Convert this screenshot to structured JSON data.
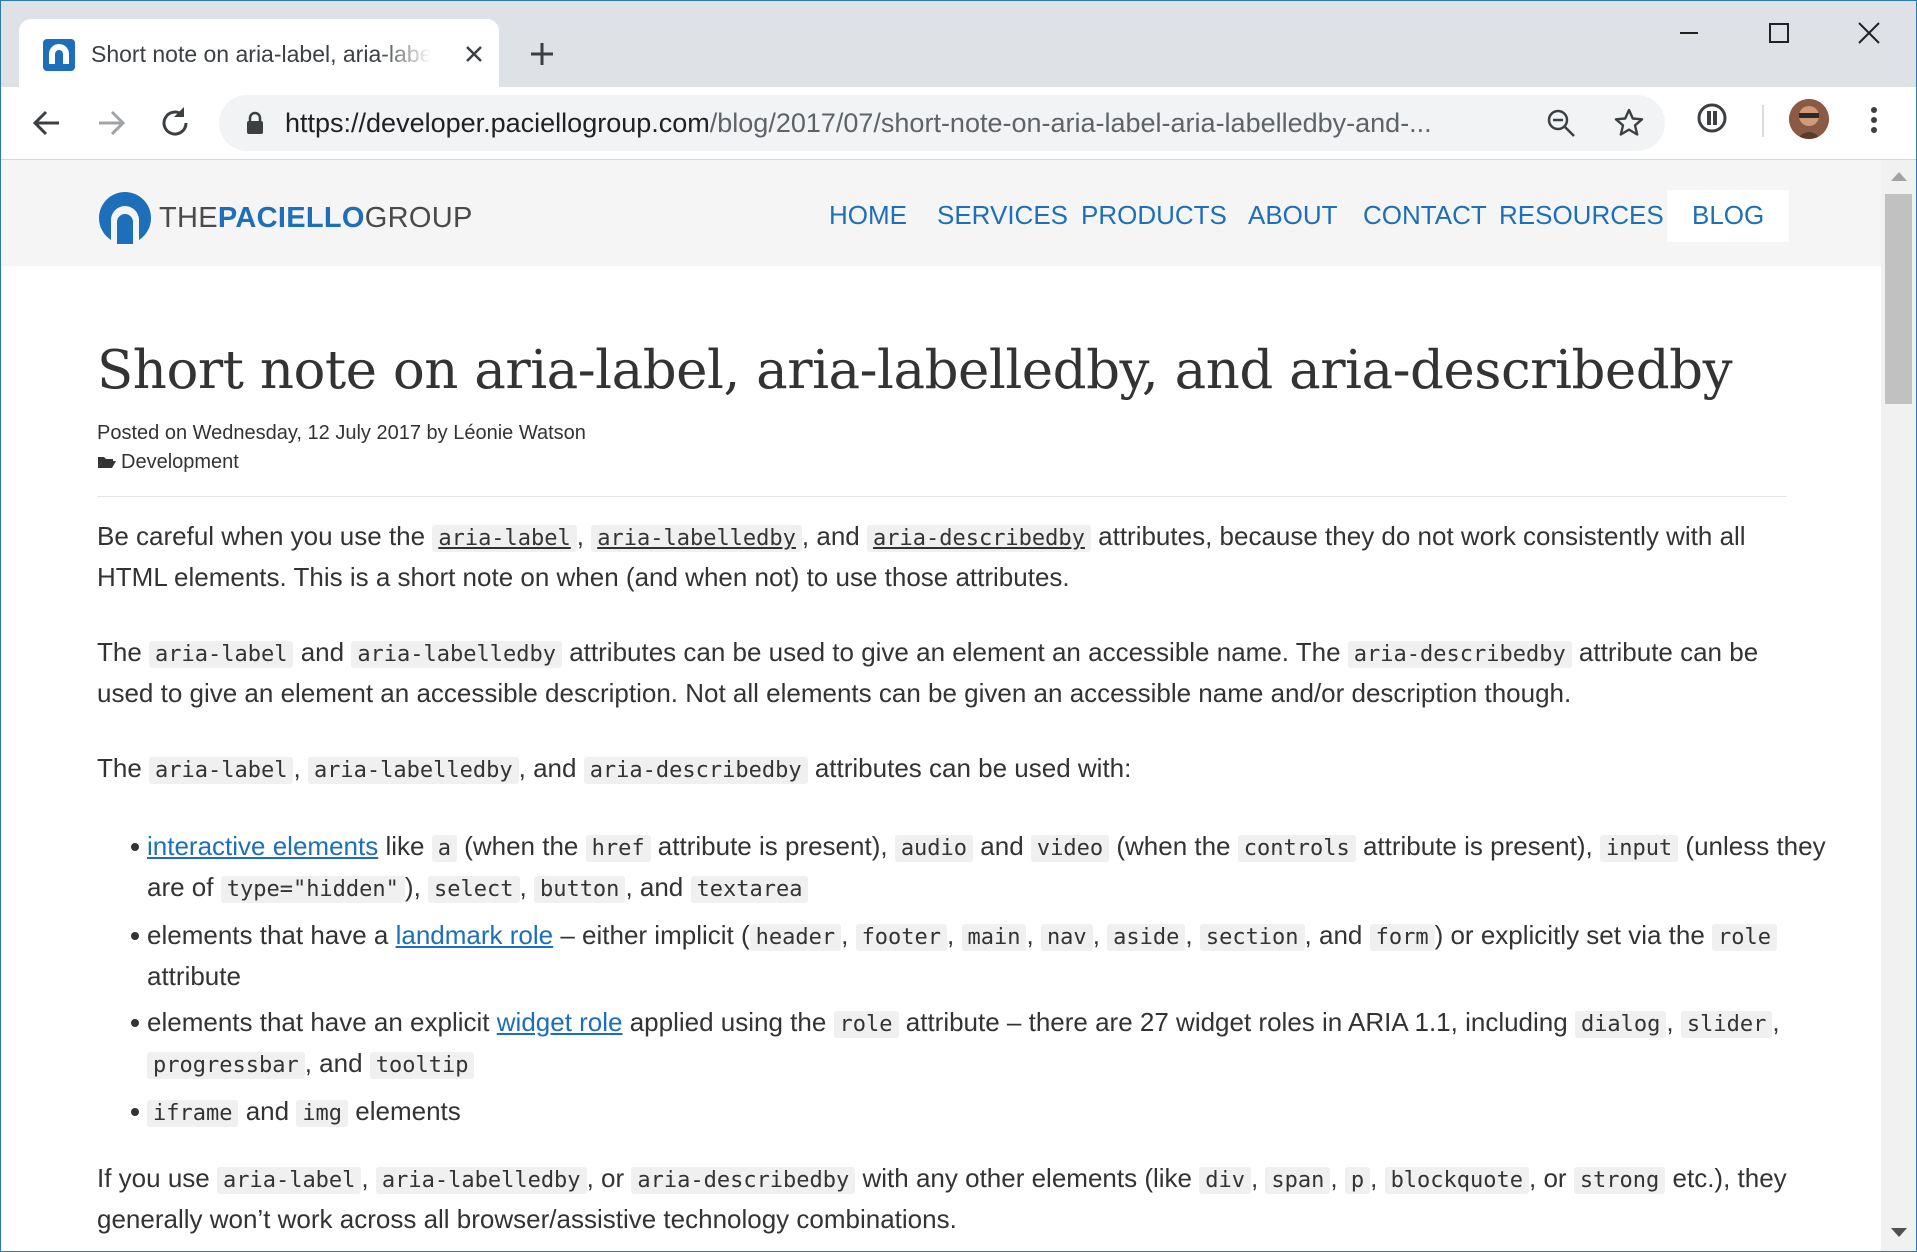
{
  "browser": {
    "tab_title": "Short note on aria-label, aria-labelledby, and aria-describedby",
    "url_host": "https://developer.paciellogroup.com",
    "url_path": "/blog/2017/07/short-note-on-aria-label-aria-labelledby-and-..."
  },
  "site": {
    "logo": {
      "part1": "THE",
      "part2": "PACIELLO",
      "part3": "GROUP"
    },
    "nav": [
      "HOME",
      "SERVICES",
      "PRODUCTS",
      "ABOUT",
      "CONTACT",
      "RESOURCES",
      "BLOG"
    ],
    "active_nav": "BLOG"
  },
  "article": {
    "title": "Short note on aria-label, aria-labelledby, and aria-describedby",
    "posted_prefix": "Posted on",
    "date": "Wednesday, 12 July 2017",
    "by": "by",
    "author": "Léonie Watson",
    "category": "Development",
    "p1": {
      "t1": "Be careful when you use the ",
      "c1": "aria-label",
      "t2": ", ",
      "c2": "aria-labelledby",
      "t3": ", and ",
      "c3": "aria-describedby",
      "t4": " attributes, because they do not work consistently with all HTML elements. This is a short note on when (and when not) to use those attributes."
    },
    "p2": {
      "t1": "The ",
      "c1": "aria-label",
      "t2": " and ",
      "c2": "aria-labelledby",
      "t3": " attributes can be used to give an element an accessible name. The ",
      "c3": "aria-describedby",
      "t4": " attribute can be used to give an element an accessible description. Not all elements can be given an accessible name and/or description though."
    },
    "p3": {
      "t1": "The ",
      "c1": "aria-label",
      "t2": ", ",
      "c2": "aria-labelledby",
      "t3": ", and ",
      "c3": "aria-describedby",
      "t4": " attributes can be used with:"
    },
    "li1": {
      "link": "interactive elements",
      "t1": " like ",
      "c1": "a",
      "t2": " (when the ",
      "c2": "href",
      "t3": " attribute is present), ",
      "c3": "audio",
      "t4": " and ",
      "c4": "video",
      "t5": " (when the ",
      "c5": "controls",
      "t6": " attribute is present), ",
      "c6": "input",
      "t7": " (unless they are of ",
      "c7": "type=\"hidden\"",
      "t8": "), ",
      "c8": "select",
      "t9": ", ",
      "c9": "button",
      "t10": ", and ",
      "c10": "textarea"
    },
    "li2": {
      "t1": "elements that have a ",
      "link": "landmark role",
      "t2": " – either implicit (",
      "c1": "header",
      "t3": ", ",
      "c2": "footer",
      "t4": ", ",
      "c3": "main",
      "t5": ", ",
      "c4": "nav",
      "t6": ", ",
      "c5": "aside",
      "t7": ", ",
      "c6": "section",
      "t8": ", and ",
      "c7": "form",
      "t9": ") or explicitly set via the ",
      "c8": "role",
      "t10": " attribute"
    },
    "li3": {
      "t1": "elements that have an explicit ",
      "link": "widget role",
      "t2": " applied using the ",
      "c1": "role",
      "t3": " attribute – there are 27 widget roles in ARIA 1.1, including ",
      "c2": "dialog",
      "t4": ", ",
      "c3": "slider",
      "t5": ", ",
      "c4": "progressbar",
      "t6": ", and ",
      "c5": "tooltip"
    },
    "li4": {
      "c1": "iframe",
      "t1": " and ",
      "c2": "img",
      "t2": " elements"
    },
    "p4": {
      "t1": "If you use ",
      "c1": "aria-label",
      "t2": ", ",
      "c2": "aria-labelledby",
      "t3": ", or ",
      "c3": "aria-describedby",
      "t4": " with any other elements (like ",
      "c4": "div",
      "t5": ", ",
      "c5": "span",
      "t6": ", ",
      "c6": "p",
      "t7": ", ",
      "c7": "blockquote",
      "t8": ", or ",
      "c8": "strong",
      "t9": " etc.), they generally won’t work across all browser/assistive technology combinations."
    }
  },
  "colors": {
    "brand": "#1e6fb9",
    "text": "#333333",
    "code_bg": "#f0f0f0"
  }
}
